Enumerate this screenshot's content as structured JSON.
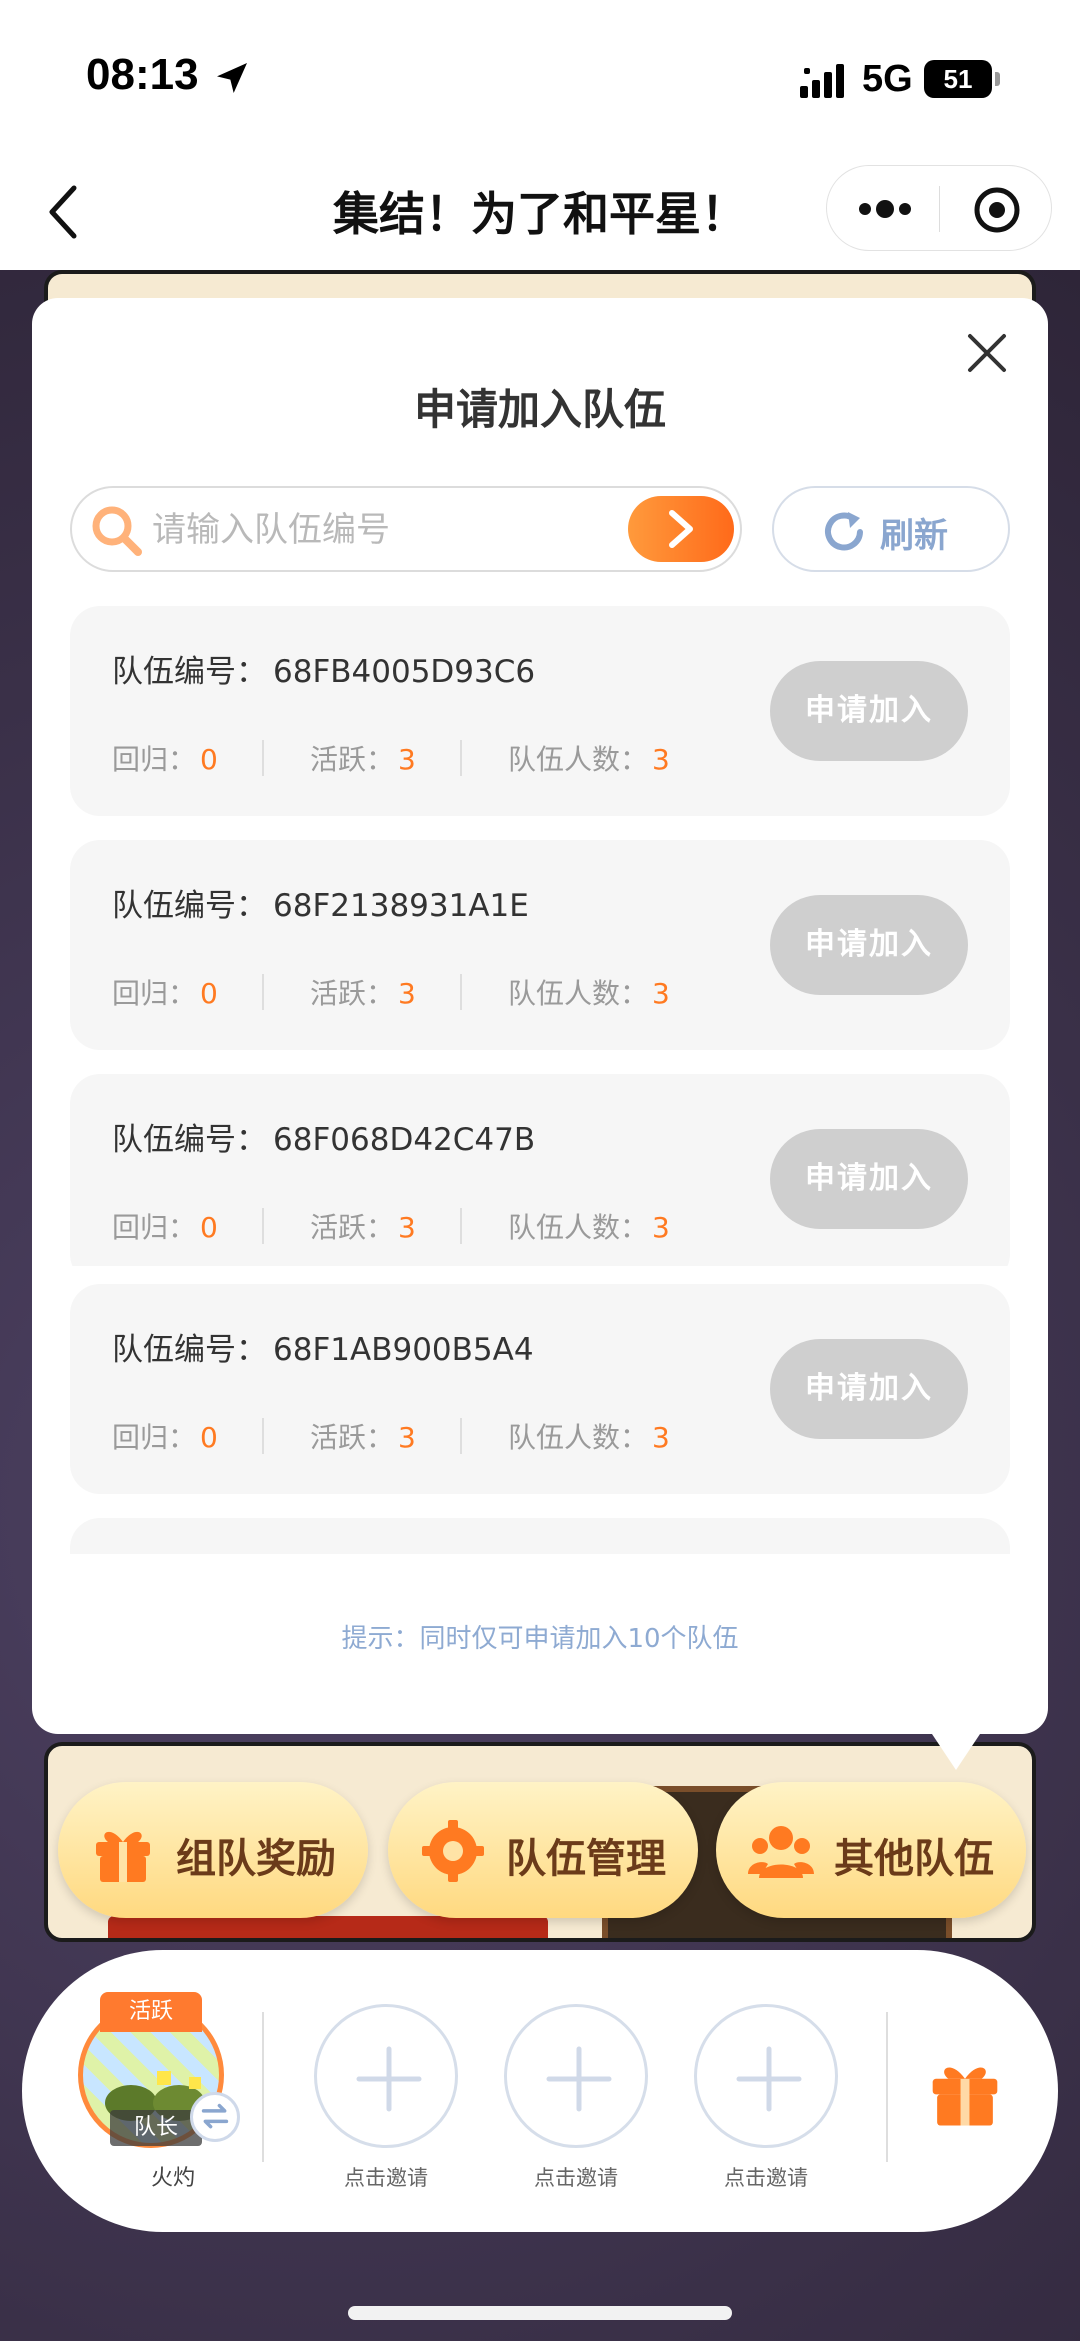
{
  "status_bar": {
    "time": "08:13",
    "network": "5G",
    "battery": "51"
  },
  "nav": {
    "title": "集结！为了和平星！"
  },
  "modal": {
    "title": "申请加入队伍",
    "search_placeholder": "请输入队伍编号",
    "refresh_label": "刷新",
    "id_label": "队伍编号：",
    "labels": {
      "return": "回归：",
      "active": "活跃：",
      "members": "队伍人数："
    },
    "join_label": "申请加入",
    "teams": [
      {
        "id": "68FB4005D93C6",
        "return": "0",
        "active": "3",
        "members": "3"
      },
      {
        "id": "68F2138931A1E",
        "return": "0",
        "active": "3",
        "members": "3"
      },
      {
        "id": "68F068D42C47B",
        "return": "0",
        "active": "3",
        "members": "3"
      },
      {
        "id": "68F1AB900B5A4",
        "return": "0",
        "active": "3",
        "members": "3"
      }
    ],
    "tip": "提示：同时仅可申请加入10个队伍"
  },
  "actions": [
    {
      "label": "组队奖励",
      "icon": "gift-icon"
    },
    {
      "label": "队伍管理",
      "icon": "gear-icon"
    },
    {
      "label": "其他队伍",
      "icon": "people-icon"
    }
  ],
  "team_panel": {
    "captain_badge": "活跃",
    "captain_tag": "队长",
    "captain_name": "火灼",
    "invite_label": "点击邀请"
  },
  "colors": {
    "accent_orange": "#ff7a21",
    "tip_blue": "#8eaad2",
    "join_disabled": "#cfcfcf"
  }
}
